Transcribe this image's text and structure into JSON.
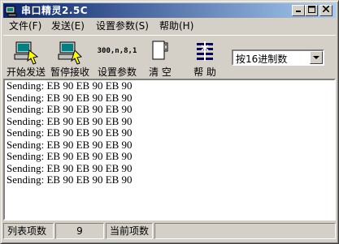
{
  "window": {
    "title": "串口精灵2.5C"
  },
  "menu": [
    {
      "label": "文件(F)"
    },
    {
      "label": "发送(E)"
    },
    {
      "label": "设置参数(S)"
    },
    {
      "label": "帮助(H)"
    }
  ],
  "toolbar": {
    "start_send": "开始发送",
    "pause_receive": "暂停接收",
    "settings": "设置参数",
    "clear": "清 空",
    "help": "帮 助",
    "settings_icon_text": "300,n,8,1"
  },
  "format_select": {
    "value": "按16进制数"
  },
  "list": {
    "rows": [
      "Sending: EB 90 EB 90 EB 90",
      "Sending: EB 90 EB 90 EB 90",
      "Sending: EB 90 EB 90 EB 90",
      "Sending: EB 90 EB 90 EB 90",
      "Sending: EB 90 EB 90 EB 90",
      "Sending: EB 90 EB 90 EB 90",
      "Sending: EB 90 EB 90 EB 90",
      "Sending: EB 90 EB 90 EB 90",
      "Sending: EB 90 EB 90 EB 90"
    ]
  },
  "status": {
    "list_count_label": "列表项数",
    "list_count_value": "9",
    "current_item_label": "当前项数",
    "current_item_value": ""
  },
  "colors": {
    "title_start": "#0a246a",
    "title_end": "#a6caf0",
    "face": "#d4d0c8"
  }
}
